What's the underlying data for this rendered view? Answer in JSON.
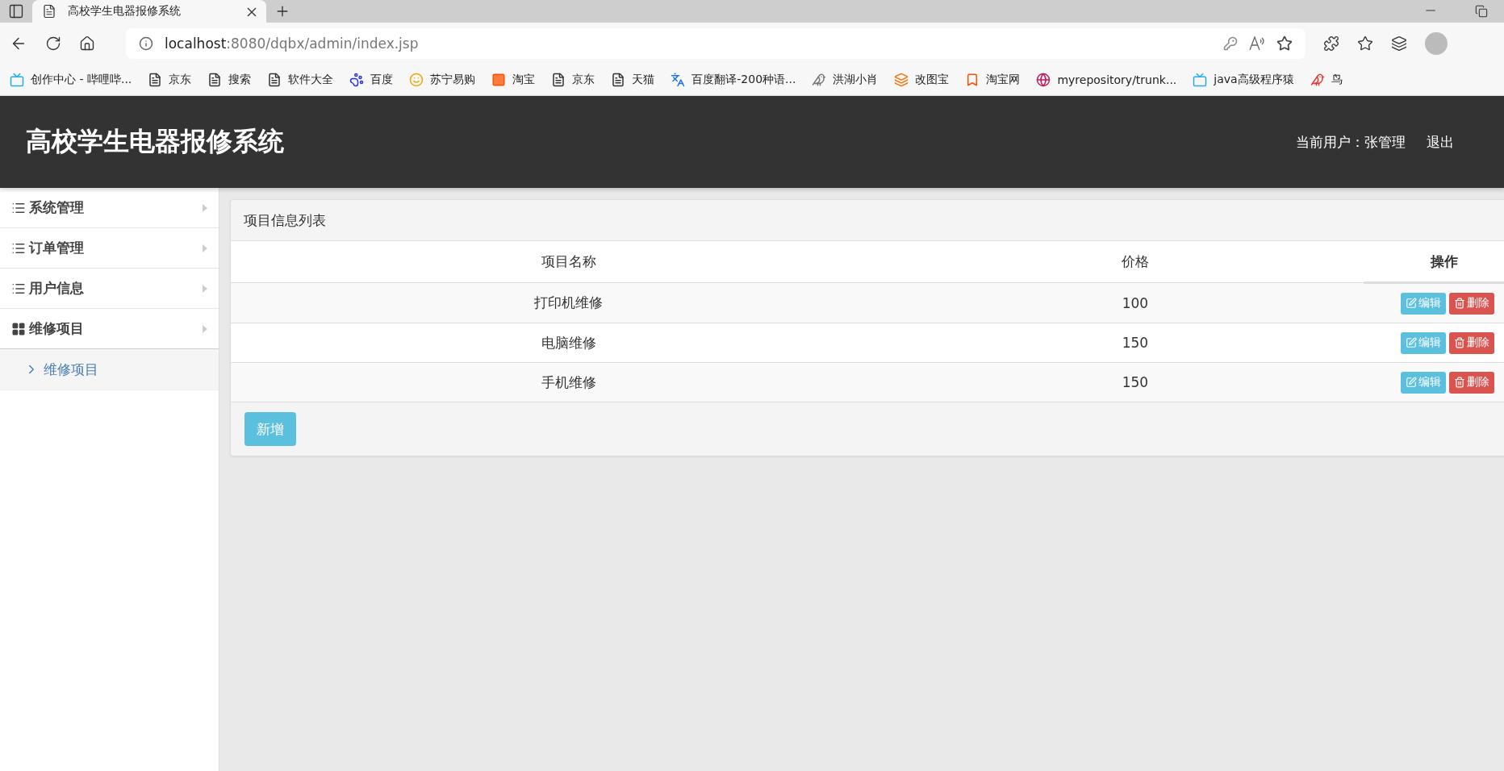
{
  "browser": {
    "tab_title": "高校学生电器报修系统",
    "url_host": "localhost",
    "url_path": ":8080/dqbx/admin/index.jsp",
    "bookmarks": [
      {
        "label": "创作中心 - 哔哩哔...",
        "kind": "tv"
      },
      {
        "label": "京东",
        "kind": "page"
      },
      {
        "label": "搜索",
        "kind": "page"
      },
      {
        "label": "软件大全",
        "kind": "page"
      },
      {
        "label": "百度",
        "kind": "paw"
      },
      {
        "label": "苏宁易购",
        "kind": "lion"
      },
      {
        "label": "淘宝",
        "kind": "tao"
      },
      {
        "label": "京东",
        "kind": "page"
      },
      {
        "label": "天猫",
        "kind": "page"
      },
      {
        "label": "百度翻译-200种语...",
        "kind": "translate"
      },
      {
        "label": "洪湖小肖",
        "kind": "bird"
      },
      {
        "label": "改图宝",
        "kind": "square"
      },
      {
        "label": "淘宝网",
        "kind": "taotext"
      },
      {
        "label": "myrepository/trunk...",
        "kind": "globe"
      },
      {
        "label": "java高级程序猿",
        "kind": "tv"
      },
      {
        "label": "鸟",
        "kind": "swallow"
      }
    ]
  },
  "header": {
    "title": "高校学生电器报修系统",
    "user": "当前用户：张管理",
    "logout": "退出"
  },
  "sidebar": {
    "items": [
      {
        "label": "系统管理",
        "kind": "list",
        "expanded": false
      },
      {
        "label": "订单管理",
        "kind": "list",
        "expanded": false
      },
      {
        "label": "用户信息",
        "kind": "list",
        "expanded": false
      },
      {
        "label": "维修项目",
        "kind": "grid",
        "expanded": true,
        "children": [
          {
            "label": "维修项目",
            "selected": true
          }
        ]
      }
    ]
  },
  "panel": {
    "title": "项目信息列表",
    "table": {
      "columns": [
        "项目名称",
        "价格",
        "操作"
      ],
      "rows": [
        {
          "name": "打印机维修",
          "price": "100",
          "actions": [
            {
              "kind": "edit",
              "label": "编辑"
            },
            {
              "kind": "delete",
              "label": "删除"
            }
          ]
        },
        {
          "name": "电脑维修",
          "price": "150",
          "actions": [
            {
              "kind": "edit",
              "label": "编辑"
            },
            {
              "kind": "delete",
              "label": "删除"
            }
          ]
        },
        {
          "name": "手机维修",
          "price": "150",
          "actions": [
            {
              "kind": "edit",
              "label": "编辑"
            },
            {
              "kind": "delete",
              "label": "删除"
            }
          ]
        }
      ]
    },
    "add_button": "新增"
  }
}
